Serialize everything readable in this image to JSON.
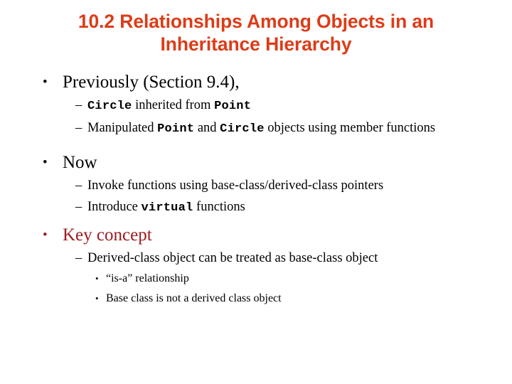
{
  "slide": {
    "title": "10.2  Relationships Among Objects in an\nInheritance Hierarchy",
    "title_color": "#DC3C17",
    "accent_color": "#9E1B20",
    "text_color": "#000000",
    "background_color": "#FFFFFF",
    "bullets": {
      "level1_glyph": "•",
      "level2_glyph": "–",
      "level3_glyph": "•"
    },
    "content": [
      {
        "level": 1,
        "text": "Previously (Section 9.4),",
        "accent": false
      },
      {
        "level": 2,
        "text": "Circle inherited from Point",
        "parts": [
          {
            "text": "Circle",
            "style": "code"
          },
          {
            "text": " inherited from ",
            "style": "normal"
          },
          {
            "text": "Point",
            "style": "code"
          }
        ]
      },
      {
        "level": 2,
        "text": "Manipulated Point and Circle objects using member functions",
        "parts": [
          {
            "text": "Manipulated ",
            "style": "normal"
          },
          {
            "text": "Point",
            "style": "code"
          },
          {
            "text": " and ",
            "style": "normal"
          },
          {
            "text": "Circle",
            "style": "code"
          },
          {
            "text": " objects using member functions",
            "style": "normal"
          }
        ]
      },
      {
        "level": 1,
        "text": "Now",
        "accent": false
      },
      {
        "level": 2,
        "text": "Invoke functions using base-class/derived-class pointers",
        "parts": [
          {
            "text": "Invoke functions using base-class/derived-class pointers",
            "style": "normal"
          }
        ]
      },
      {
        "level": 2,
        "text": "Introduce virtual functions",
        "parts": [
          {
            "text": "Introduce ",
            "style": "normal"
          },
          {
            "text": "virtual",
            "style": "code"
          },
          {
            "text": " functions",
            "style": "normal"
          }
        ]
      },
      {
        "level": 1,
        "text": "Key concept",
        "accent": true
      },
      {
        "level": 2,
        "text": "Derived-class object can be treated as base-class object",
        "parts": [
          {
            "text": "Derived-class object can be treated as base-class object",
            "style": "normal"
          }
        ]
      },
      {
        "level": 3,
        "text": "“is-a” relationship"
      },
      {
        "level": 3,
        "text": "Base class is not a derived class object"
      }
    ]
  }
}
